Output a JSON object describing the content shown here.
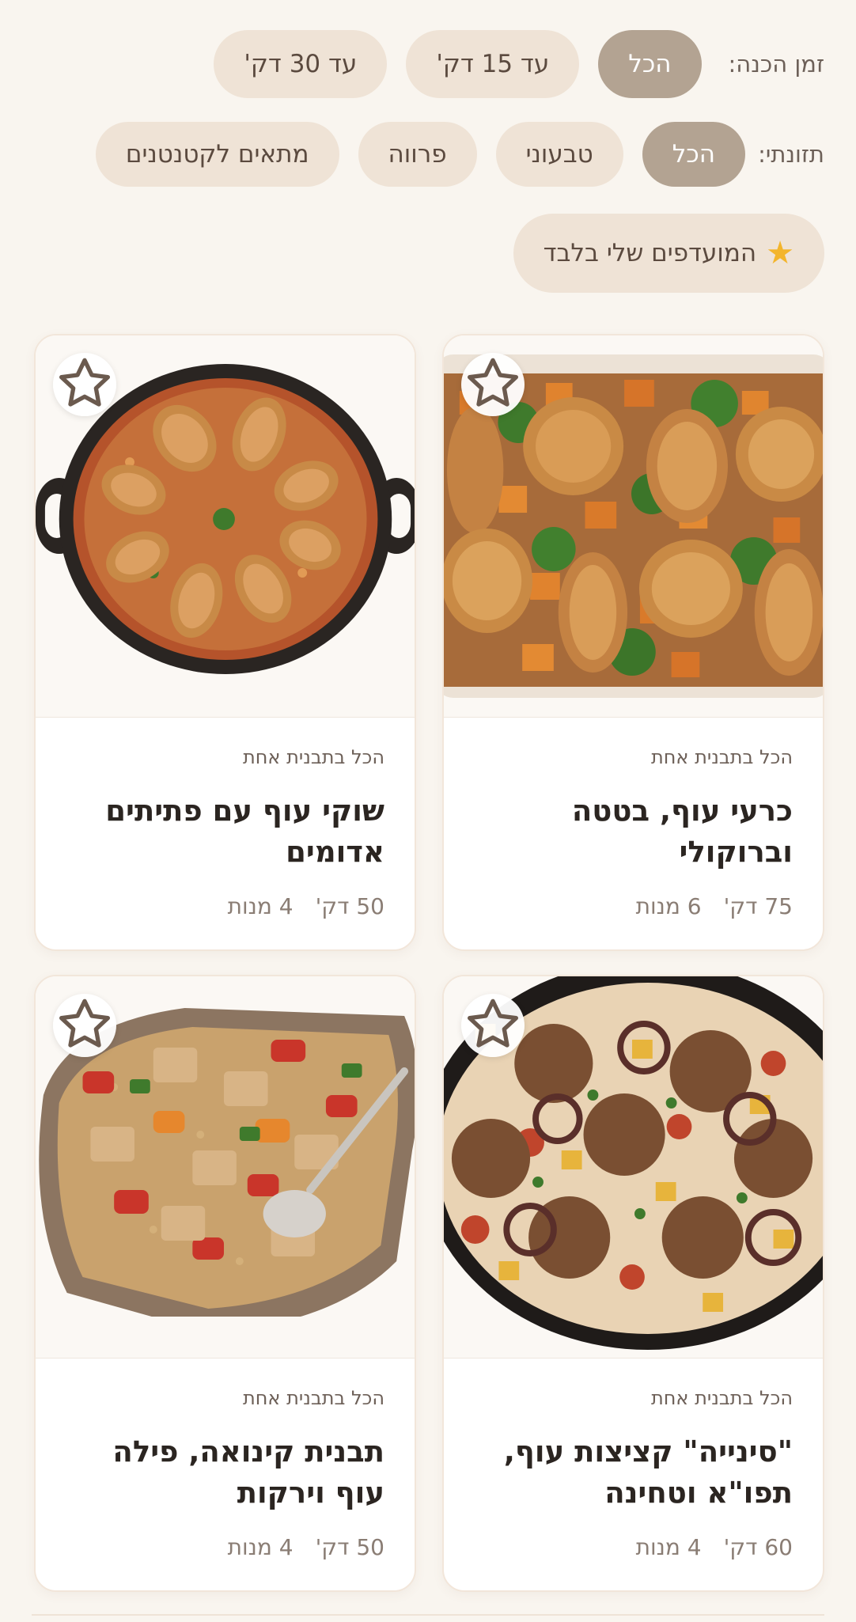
{
  "filters": {
    "time": {
      "label": "זמן הכנה:",
      "options": [
        "הכל",
        "עד 15 דק'",
        "עד 30 דק'"
      ],
      "selected": "הכל"
    },
    "diet": {
      "label": "תזונתי:",
      "options": [
        "הכל",
        "טבעוני",
        "פרווה",
        "מתאים לקטנטנים"
      ],
      "selected": "הכל"
    },
    "favorites": {
      "label": "המועדפים שלי בלבד",
      "icon": "star-emoji-icon",
      "icon_color": "#f3b52c"
    }
  },
  "colors": {
    "background": "#f9f5ef",
    "chip": "#efe3d6",
    "chip_active": "#b3a392",
    "title": "#2b2521"
  },
  "recipes": [
    {
      "category": "הכל בתבנית אחת",
      "title": "כרעי עוף, בטטה וברוקולי",
      "time": "75 דק'",
      "servings": "6 מנות",
      "image": "chicken-sweet-potato-broccoli-tray"
    },
    {
      "category": "הכל בתבנית אחת",
      "title": "שוקי עוף עם פתיתים אדומים",
      "time": "50 דק'",
      "servings": "4 מנות",
      "image": "drumsticks-ptitim-pan"
    },
    {
      "category": "הכל בתבנית אחת",
      "title": "\"סינייה\" קציצות עוף, תפו\"א וטחינה",
      "time": "60 דק'",
      "servings": "4 מנות",
      "image": "chicken-patties-tahini-pan"
    },
    {
      "category": "הכל בתבנית אחת",
      "title": "תבנית קינואה, פילה עוף וירקות",
      "time": "50 דק'",
      "servings": "4 מנות",
      "image": "quinoa-chicken-vegetable-dish"
    }
  ]
}
